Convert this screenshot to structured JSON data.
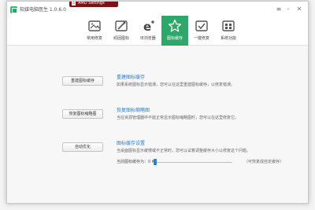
{
  "window": {
    "title": "软媒电脑医生 1.0.6.0",
    "menu_glyph": "≡",
    "min_glyph": "–",
    "close_glyph": "✕"
  },
  "overlay": {
    "title": "AMD Settings",
    "icon_letter": "a"
  },
  "tabs": [
    {
      "label": "常用修复",
      "icon": "image-icon"
    },
    {
      "label": "顽固图标",
      "icon": "brush-icon"
    },
    {
      "label": "IE浏览器",
      "icon": "ie-icon"
    },
    {
      "label": "图标缓存",
      "icon": "star-icon",
      "active": true
    },
    {
      "label": "一键修复",
      "icon": "repair-icon"
    },
    {
      "label": "系统功能",
      "icon": "apps-icon"
    }
  ],
  "sections": [
    {
      "button": "重建图标缓存",
      "title": "重建图标缓存",
      "desc": "如果系统图标显示错误，您可以在这里重建图标缓存，以修复错误。"
    },
    {
      "button": "恢复图标缩略图",
      "title": "恢复图标缩略图",
      "desc": "当在资源管理器中不能正常显示图标缩略图时，您可以在这里修复它。"
    },
    {
      "button": "自动优化",
      "title": "图标缓存设置",
      "desc": "当桌面图标显示缓慢或不正常时，您可以试着调整缓存大小以修复这个问题。"
    }
  ],
  "cache": {
    "label": "当前图标缓存为：0 KB",
    "hint": "（可恢复成自定缓存）",
    "level": 0.02
  },
  "colors": {
    "accent": "#2ea86a",
    "link": "#2b7fd1"
  }
}
